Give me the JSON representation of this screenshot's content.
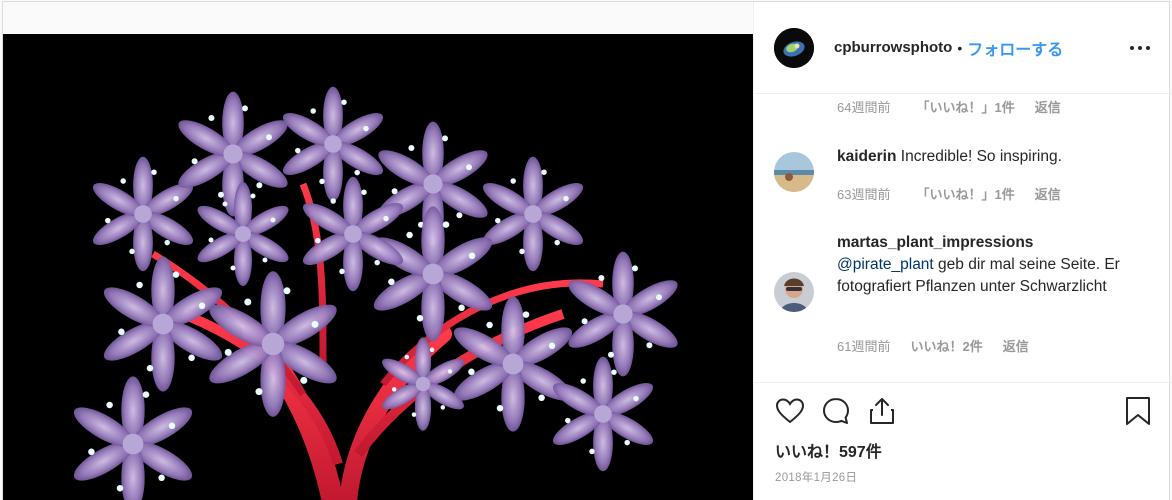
{
  "post": {
    "username": "cpburrowsphoto",
    "separator": "•",
    "follow_label": "フォローする",
    "more_icon": "more-horizontal-icon"
  },
  "comments": {
    "top_meta": {
      "time": "64週間前",
      "likes": "「いいね！」1件",
      "reply": "返信"
    },
    "items": [
      {
        "user": "kaiderin",
        "text": "Incredible! So inspiring.",
        "time": "63週間前",
        "likes": "「いいね！」1件",
        "reply": "返信"
      },
      {
        "user": "martas_plant_impressions",
        "mention": "@pirate_plant",
        "text": " geb dir mal seine Seite. Er fotografiert Pflanzen unter Schwarzlicht",
        "time": "61週間前",
        "likes": "いいね！2件",
        "reply": "返信"
      }
    ]
  },
  "actions": {
    "like_icon": "heart-icon",
    "comment_icon": "comment-icon",
    "share_icon": "share-icon",
    "save_icon": "bookmark-icon",
    "like_count": "いいね！597件",
    "date": "2018年1月26日"
  }
}
